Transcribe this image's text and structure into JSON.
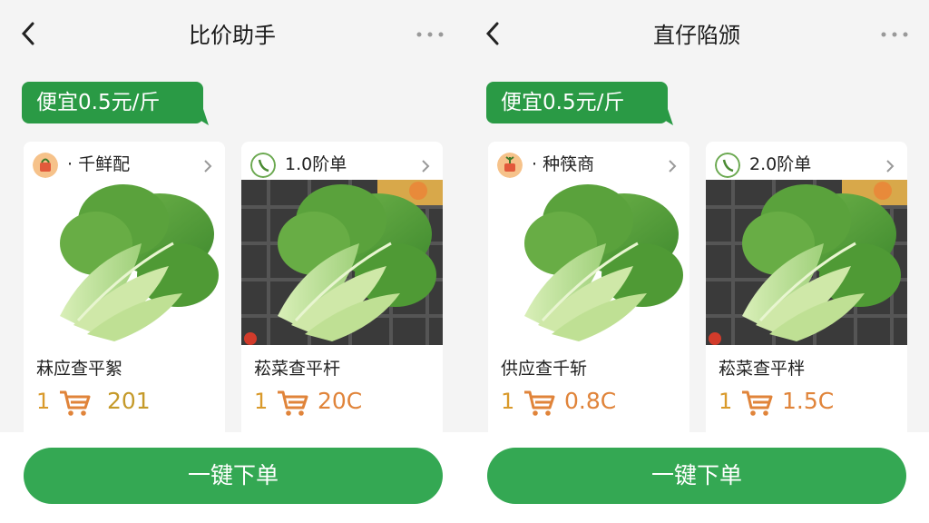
{
  "left_panel": {
    "title": "比价助手",
    "badge": "便宜0.5元/斤",
    "cards": [
      {
        "shop_name": "· 千鲜配",
        "product_name": "菻应查平絮",
        "qty": "1",
        "price": "201",
        "shop_icon": "shop-basket-icon"
      },
      {
        "shop_name": "1.0阶单",
        "product_name": "菘菜查平杆",
        "qty": "1",
        "price": "20C",
        "shop_icon": "shop-leaf-icon"
      }
    ],
    "order_button": "一键下单"
  },
  "right_panel": {
    "title": "直仔陷颁",
    "badge": "便宜0.5元/斤",
    "cards": [
      {
        "shop_name": "· 种筷商",
        "product_name": "供应查千斩",
        "qty": "1",
        "price": "0.8C",
        "shop_icon": "shop-sprout-icon"
      },
      {
        "shop_name": "2.0阶单",
        "product_name": "菘菜查平柈",
        "qty": "1",
        "price": "1.5C",
        "shop_icon": "shop-leaf-icon"
      }
    ],
    "order_button": "一键下单"
  },
  "colors": {
    "accent_green": "#2a9a45",
    "button_green": "#34a853",
    "price_gold": "#c59a2a",
    "price_orange": "#e0843a"
  }
}
